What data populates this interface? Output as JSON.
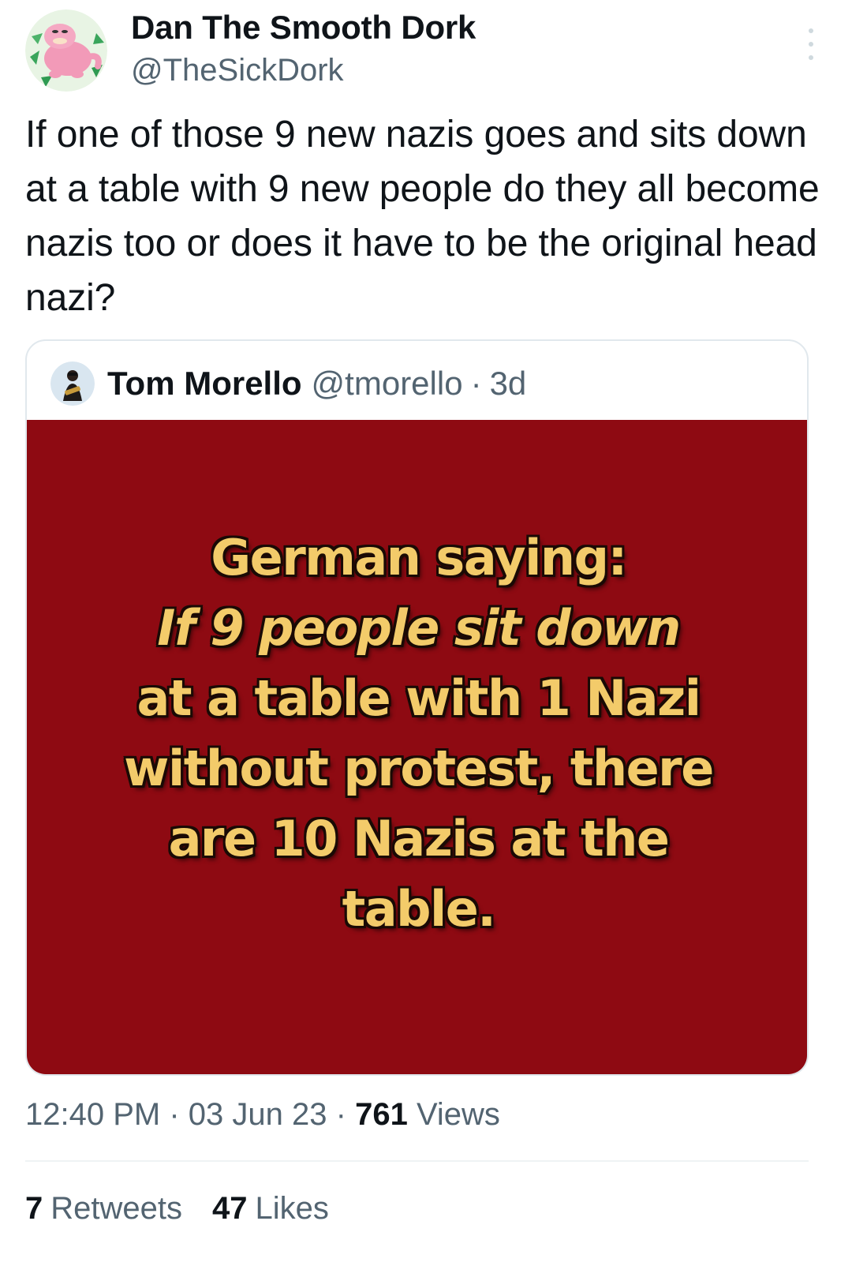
{
  "author": {
    "display_name": "Dan The Smooth Dork",
    "handle": "@TheSickDork"
  },
  "tweet": {
    "text": "If one of those 9 new nazis goes and sits down at a table with 9 new people do they all become nazis too or does it have to be the original head nazi?"
  },
  "quoted": {
    "name": "Tom Morello",
    "handle": "@tmorello",
    "separator": "·",
    "time": "3d",
    "image_text": {
      "line1": "German saying:",
      "line2": "If 9 people sit down",
      "line3": "at a table with 1 Nazi",
      "line4": "without protest, there",
      "line5": "are 10 Nazis at the",
      "line6": "table."
    }
  },
  "meta": {
    "time": "12:40 PM",
    "date": "03 Jun 23",
    "separator": "·",
    "views_count": "761",
    "views_label": "Views"
  },
  "stats": {
    "retweets_count": "7",
    "retweets_label": "Retweets",
    "likes_count": "47",
    "likes_label": "Likes"
  },
  "colors": {
    "quote_image_bg": "#8e0a12",
    "saying_text": "#f3cb6a",
    "secondary_text": "#536471"
  }
}
